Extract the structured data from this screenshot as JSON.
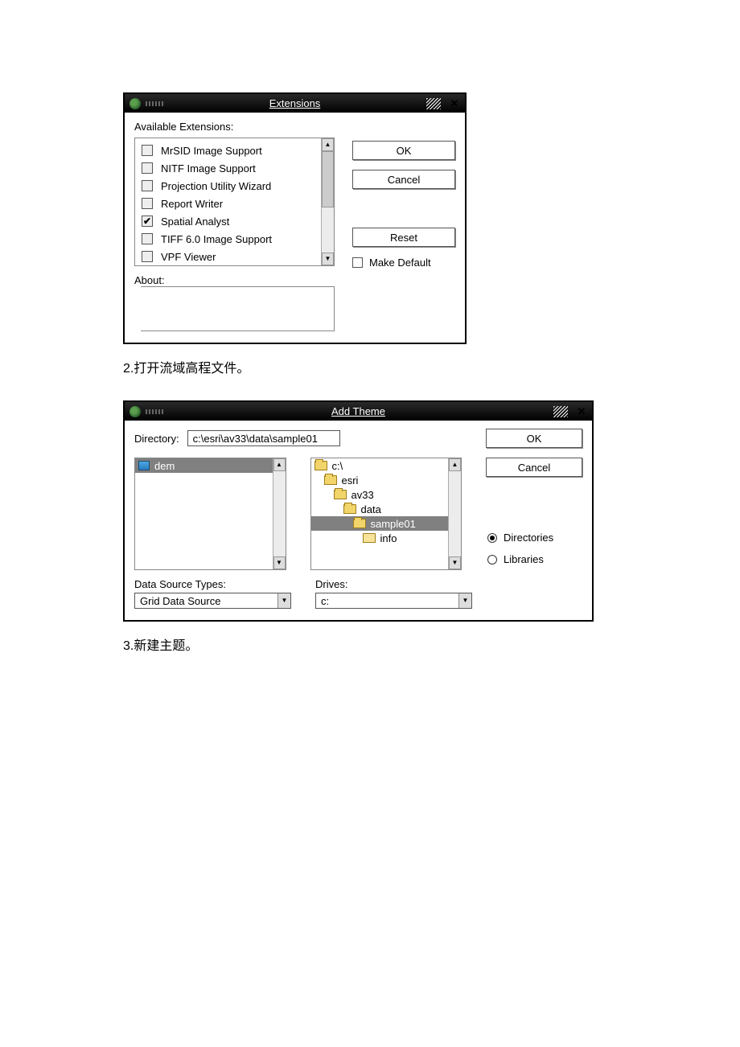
{
  "dialog1": {
    "title": "Extensions",
    "label_available": "Available Extensions:",
    "items": [
      {
        "label": "MrSID Image Support",
        "checked": false
      },
      {
        "label": "NITF Image Support",
        "checked": false
      },
      {
        "label": "Projection Utility Wizard",
        "checked": false
      },
      {
        "label": "Report Writer",
        "checked": false
      },
      {
        "label": "Spatial Analyst",
        "checked": true
      },
      {
        "label": "TIFF 6.0 Image Support",
        "checked": false
      },
      {
        "label": "VPF Viewer",
        "checked": false
      }
    ],
    "btn_ok": "OK",
    "btn_cancel": "Cancel",
    "btn_reset": "Reset",
    "chk_default": "Make Default",
    "label_about": "About:"
  },
  "caption2": "2.打开流域高程文件。",
  "dialog2": {
    "title": "Add Theme",
    "label_directory": "Directory:",
    "directory_value": "c:\\esri\\av33\\data\\sample01",
    "files": [
      {
        "label": "dem",
        "selected": true
      }
    ],
    "tree": [
      {
        "label": "c:\\",
        "indent": 0,
        "open": true,
        "selected": false
      },
      {
        "label": "esri",
        "indent": 1,
        "open": true,
        "selected": false
      },
      {
        "label": "av33",
        "indent": 2,
        "open": true,
        "selected": false
      },
      {
        "label": "data",
        "indent": 3,
        "open": true,
        "selected": false
      },
      {
        "label": "sample01",
        "indent": 4,
        "open": true,
        "selected": true
      },
      {
        "label": "info",
        "indent": 5,
        "open": false,
        "selected": false
      }
    ],
    "btn_ok": "OK",
    "btn_cancel": "Cancel",
    "radio_directories": "Directories",
    "radio_libraries": "Libraries",
    "label_dst": "Data Source Types:",
    "dst_value": "Grid Data Source",
    "label_drives": "Drives:",
    "drives_value": "c:"
  },
  "caption3": "3.新建主题。"
}
